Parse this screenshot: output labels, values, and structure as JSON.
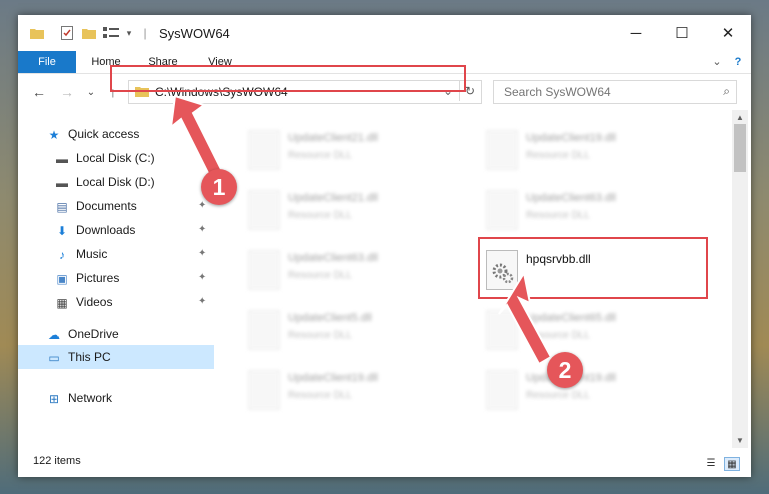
{
  "window": {
    "title": "SysWOW64",
    "controls": {
      "minimize": "─",
      "maximize": "☐",
      "close": "✕"
    }
  },
  "ribbon": {
    "tabs": [
      {
        "label": "File"
      },
      {
        "label": "Home"
      },
      {
        "label": "Share"
      },
      {
        "label": "View"
      }
    ],
    "expand_icon": "⌄",
    "help_icon": "?"
  },
  "navigation": {
    "back_icon": "←",
    "forward_icon": "→",
    "recent_icon": "⌄",
    "up_icon": "↑",
    "address": "C:\\Windows\\SysWOW64",
    "address_dropdown_icon": "⌄",
    "refresh_icon": "↻",
    "search_placeholder": "Search SysWOW64"
  },
  "sidebar": {
    "items": [
      {
        "label": "Quick access",
        "icon": "star-icon",
        "glyph": "★",
        "color": "#1c7fd8"
      },
      {
        "label": "Local Disk (C:)",
        "icon": "drive-icon",
        "glyph": "▬",
        "color": "#555555",
        "pinned": false
      },
      {
        "label": "Local Disk (D:)",
        "icon": "drive-icon",
        "glyph": "▬",
        "color": "#555555",
        "pinned": false
      },
      {
        "label": "Documents",
        "icon": "documents-icon",
        "glyph": "▤",
        "color": "#4a6fa5",
        "pinned": true
      },
      {
        "label": "Downloads",
        "icon": "download-icon",
        "glyph": "⬇",
        "color": "#1c7fd8",
        "pinned": true
      },
      {
        "label": "Music",
        "icon": "music-icon",
        "glyph": "♪",
        "color": "#1c7fd8",
        "pinned": true
      },
      {
        "label": "Pictures",
        "icon": "pictures-icon",
        "glyph": "▣",
        "color": "#4a86c8",
        "pinned": true
      },
      {
        "label": "Videos",
        "icon": "videos-icon",
        "glyph": "▦",
        "color": "#444444",
        "pinned": true
      },
      {
        "label": "OneDrive",
        "icon": "cloud-icon",
        "glyph": "☁",
        "color": "#1c7fd8"
      },
      {
        "label": "This PC",
        "icon": "computer-icon",
        "glyph": "▭",
        "color": "#2b79c2"
      },
      {
        "label": "Network",
        "icon": "network-icon",
        "glyph": "⊞",
        "color": "#2b79c2"
      }
    ],
    "pin_glyph": "📌",
    "selected": "This PC"
  },
  "files": [
    {
      "name": "UpdateClient21.dll",
      "type": "Resource DLL"
    },
    {
      "name": "UpdateClient19.dll",
      "type": "Resource DLL"
    },
    {
      "name": "UpdateClient21.dll",
      "type": "Resource DLL"
    },
    {
      "name": "UpdateClient63.dll",
      "type": "Resource DLL"
    },
    {
      "name": "UpdateClient63.dll",
      "type": "Resource DLL"
    },
    {
      "name": "hpqsrvbb.dll",
      "type": ""
    },
    {
      "name": "UpdateClient5.dll",
      "type": "Resource DLL"
    },
    {
      "name": "UpdateClient65.dll",
      "type": "Resource DLL"
    },
    {
      "name": "UpdateClient19.dll",
      "type": "Resource DLL"
    },
    {
      "name": "UpdateClient19.dll",
      "type": "Resource DLL"
    }
  ],
  "status": {
    "item_count": "122 items"
  },
  "annotations": {
    "step1": "1",
    "step2": "2",
    "color": "#e5565a"
  },
  "colors": {
    "accent": "#1979ca",
    "highlight": "#e0464b",
    "selection": "#cce8ff"
  }
}
